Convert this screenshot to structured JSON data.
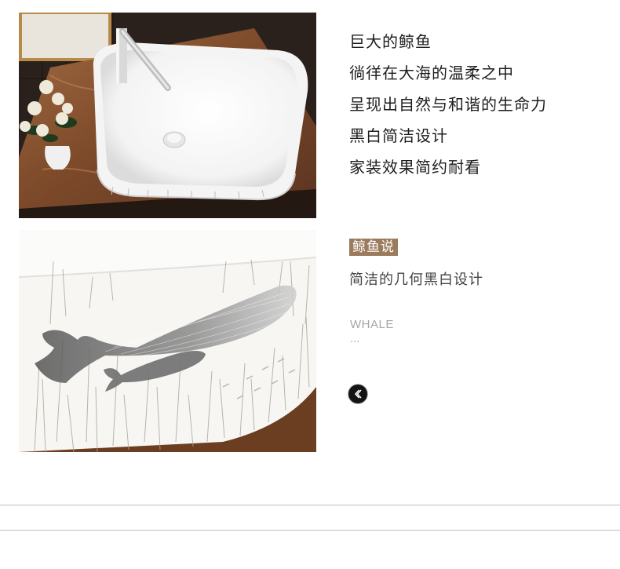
{
  "features": [
    "巨大的鲸鱼",
    "徜徉在大海的温柔之中",
    "呈现出自然与和谐的生命力",
    "黑白简洁设计",
    "家装效果简约耐看"
  ],
  "story": {
    "tag": "鲸鱼说",
    "subtitle": "简洁的几何黑白设计",
    "english": "WHALE",
    "ellipsis": "..."
  },
  "icons": {
    "back": "chevron-left-icon"
  },
  "colors": {
    "tag_bg": "#9c7a5c",
    "marble": "#7a4a2a",
    "button": "#141414"
  }
}
